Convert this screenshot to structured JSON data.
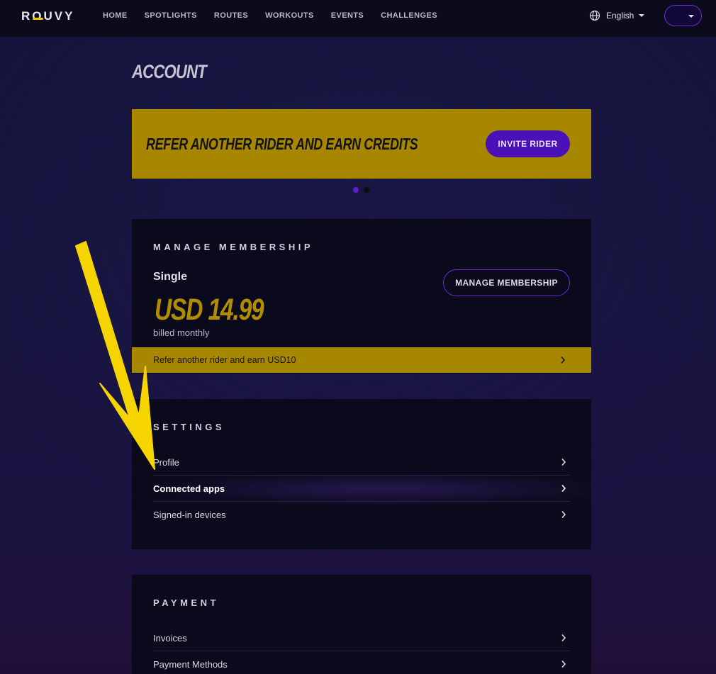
{
  "nav": {
    "logo": "ROUVY",
    "links": [
      "HOME",
      "SPOTLIGHTS",
      "ROUTES",
      "WORKOUTS",
      "EVENTS",
      "CHALLENGES"
    ],
    "language": "English"
  },
  "page": {
    "title": "ACCOUNT"
  },
  "promo": {
    "text": "REFER ANOTHER RIDER AND EARN CREDITS",
    "button": "INVITE RIDER",
    "dots": [
      {
        "active": true,
        "color": "#5a1fd0"
      },
      {
        "active": false,
        "color": "#0b0b14"
      }
    ]
  },
  "membership": {
    "heading": "MANAGE MEMBERSHIP",
    "plan": "Single",
    "price": "USD 14.99",
    "period": "billed monthly",
    "button": "MANAGE MEMBERSHIP",
    "refer": "Refer another rider and earn USD10"
  },
  "settings": {
    "heading": "SETTINGS",
    "items": [
      {
        "label": "Profile"
      },
      {
        "label": "Connected apps",
        "active": true
      },
      {
        "label": "Signed-in devices"
      }
    ]
  },
  "payment": {
    "heading": "PAYMENT",
    "items": [
      {
        "label": "Invoices"
      },
      {
        "label": "Payment Methods"
      }
    ]
  },
  "colors": {
    "accent_purple": "#4a11b8",
    "promo_gold": "#a88700",
    "annotation_arrow": "#f5d400"
  }
}
